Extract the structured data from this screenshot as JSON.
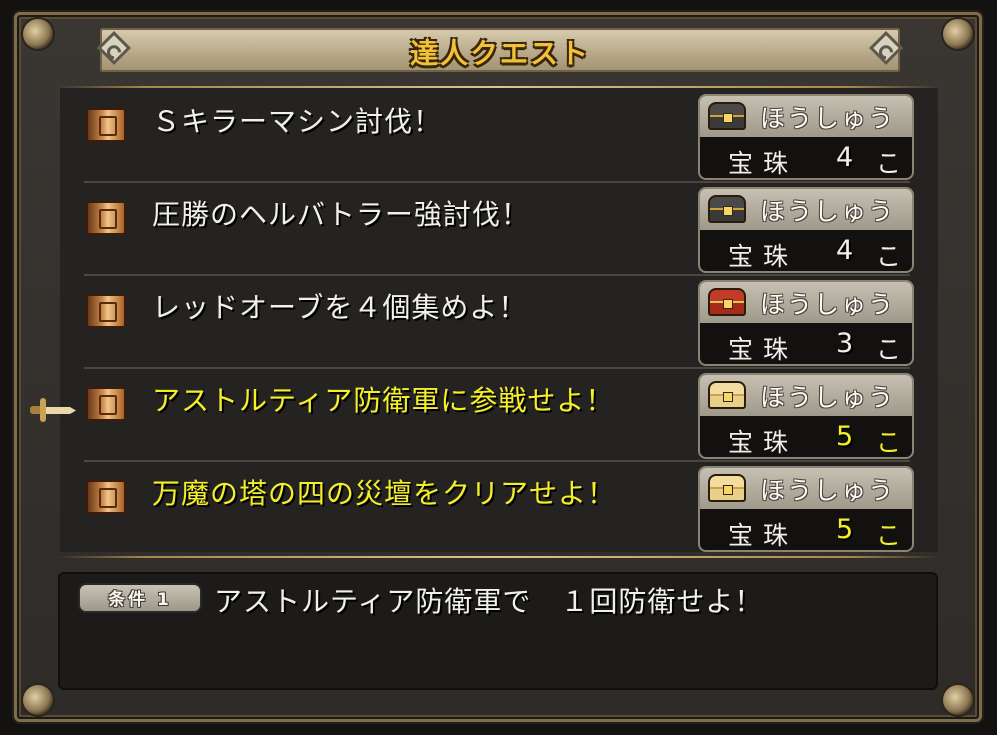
{
  "window": {
    "title": "達人クエスト"
  },
  "quests": [
    {
      "title": "Ｓキラーマシン討伐！",
      "highlighted": false,
      "reward_label": "ほうしゅう",
      "reward_item": "宝珠",
      "reward_count": "4",
      "reward_unit": "こ",
      "chest_icon": "black-chest-icon"
    },
    {
      "title": "圧勝のヘルバトラー強討伐！",
      "highlighted": false,
      "reward_label": "ほうしゅう",
      "reward_item": "宝珠",
      "reward_count": "4",
      "reward_unit": "こ",
      "chest_icon": "black-chest-icon"
    },
    {
      "title": "レッドオーブを４個集めよ！",
      "highlighted": false,
      "reward_label": "ほうしゅう",
      "reward_item": "宝珠",
      "reward_count": "3",
      "reward_unit": "こ",
      "chest_icon": "red-chest-icon"
    },
    {
      "title": "アストルティア防衛軍に参戦せよ！",
      "highlighted": true,
      "reward_label": "ほうしゅう",
      "reward_item": "宝珠",
      "reward_count": "5",
      "reward_unit": "こ",
      "chest_icon": "gold-chest-icon"
    },
    {
      "title": "万魔の塔の四の災壇をクリアせよ！",
      "highlighted": true,
      "reward_label": "ほうしゅう",
      "reward_item": "宝珠",
      "reward_count": "5",
      "reward_unit": "こ",
      "chest_icon": "gold-chest-icon"
    }
  ],
  "condition": {
    "badge": "条件 1",
    "text": "アストルティア防衛軍で　１回防衛せよ！"
  },
  "colors": {
    "highlight_text": "#f5ef2a",
    "normal_text": "#f2f0ea",
    "title_gold": "#f2c13a"
  },
  "cursor_icon": "sword-cursor-icon"
}
